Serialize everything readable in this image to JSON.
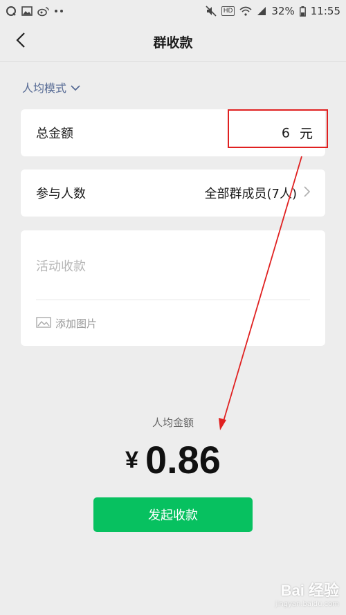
{
  "status_bar": {
    "battery": "32%",
    "time": "11:55",
    "network_badge": "HD",
    "icons_left": [
      "message-icon",
      "image-icon",
      "weibo-icon",
      "more-dots-icon"
    ],
    "icons_right": [
      "mute-icon",
      "wifi-icon",
      "signal-icon",
      "battery-icon"
    ]
  },
  "header": {
    "title": "群收款"
  },
  "mode": {
    "label": "人均模式"
  },
  "form": {
    "total_label": "总金额",
    "total_value": "6",
    "total_unit": "元",
    "people_label": "参与人数",
    "people_value": "全部群成员(7人)",
    "note_placeholder": "活动收款",
    "add_image_label": "添加图片"
  },
  "summary": {
    "avg_label": "人均金额",
    "currency": "¥",
    "avg_value": "0.86"
  },
  "actions": {
    "submit_label": "发起收款"
  },
  "watermark": {
    "main": "Bai 经验",
    "sub": "jingyan.baidu.com"
  },
  "colors": {
    "accent_green": "#07c160",
    "link_blue": "#576b95",
    "annotation_red": "#e02020",
    "background": "#ededed"
  }
}
